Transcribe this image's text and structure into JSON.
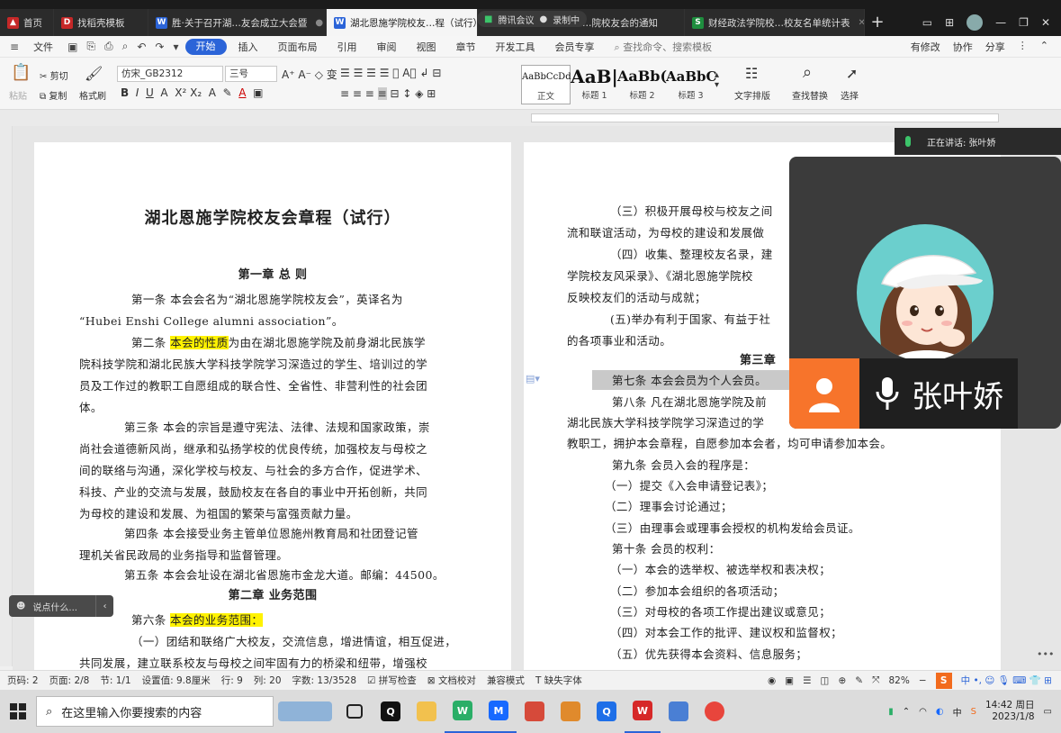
{
  "tabs": [
    {
      "label": "首页",
      "icon": "home-icon",
      "color": "#c62828"
    },
    {
      "label": "找稻壳模板",
      "icon": "docer-icon",
      "color": "#c62828"
    },
    {
      "label": "胜·关于召开湖…友会成立大会暨",
      "icon": "word-doc-icon",
      "color": "#2b64d8"
    },
    {
      "label": "湖北恩施学院校友…程（试行）(",
      "icon": "word-doc-icon",
      "color": "#2b64d8",
      "active": true
    },
    {
      "label": "…院校友会的通知",
      "icon": "word-doc-icon",
      "color": "#2b64d8"
    },
    {
      "label": "财经政法学院校…校友名单统计表",
      "icon": "sheet-icon",
      "color": "#1e8e3e"
    }
  ],
  "meeting_pill": {
    "app": "腾讯会议",
    "recording": "录制中"
  },
  "menubar": {
    "file": "文件",
    "items": [
      "开始",
      "插入",
      "页面布局",
      "引用",
      "审阅",
      "视图",
      "章节",
      "开发工具",
      "会员专享"
    ],
    "search_placeholder": "查找命令、搜索模板",
    "right": [
      "有修改",
      "协作",
      "分享"
    ]
  },
  "ribbon": {
    "paste": "粘贴",
    "cut": "剪切",
    "copy": "复制",
    "format_painter": "格式刷",
    "font_name": "仿宋_GB2312",
    "font_size": "三号",
    "styles": [
      {
        "preview": "AaBbCcDd",
        "label": "正文"
      },
      {
        "preview": "AaB|",
        "label": "标题 1"
      },
      {
        "preview": "AaBb(",
        "label": "标题 2"
      },
      {
        "preview": "AaBbC",
        "label": "标题 3"
      }
    ],
    "text_layout": "文字排版",
    "find_replace": "查找替换",
    "select": "选择"
  },
  "speaking": {
    "text": "正在讲话: 张叶娇"
  },
  "participant": {
    "name": "张叶娇"
  },
  "float_tool": {
    "placeholder": "说点什么..."
  },
  "page1": {
    "title": "湖北恩施学院校友会章程（试行）",
    "chapter1": "第一章  总    则",
    "lines": [
      "第一条   本会会名为“湖北恩施学院校友会”，英译名为",
      "“Hubei Enshi College alumni association”。",
      "第二条  ",
      "为由在湖北恩施学院及前身湖北民族学",
      "院科技学院和湖北民族大学科技学院学习深造过的学生、培训过的学",
      "员及工作过的教职工自愿组成的联合性、全省性、非营利性的社会团",
      "体。",
      "第三条   本会的宗旨是遵守宪法、法律、法规和国家政策，崇",
      "尚社会道德新风尚，继承和弘扬学校的优良传统，加强校友与母校之",
      "间的联络与沟通，深化学校与校友、与社会的多方合作，促进学术、",
      "科技、产业的交流与发展，鼓励校友在各自的事业中开拓创新，共同",
      "为母校的建设和发展、为祖国的繁荣与富强贡献力量。",
      "第四条   本会接受业务主管单位恩施州教育局和社团登记管",
      "理机关省民政局的业务指导和监督管理。",
      "第五条   本会会址设在湖北省恩施市金龙大道。邮编：44500。",
      "第六条  ",
      "（一）团结和联络广大校友，交流信息，增进情谊，相互促进，",
      "共同发展，建立联系校友与母校之间牢固有力的桥梁和纽带，增强校"
    ],
    "highlight1": "本会的性质",
    "chapter2": "第二章   业务范围",
    "highlight2": "本会的业务范围："
  },
  "page2": {
    "lines": [
      "（三）积极开展母校与校友之间",
      "流和联谊活动，为母校的建设和发展做",
      "（四）收集、整理校友名录，建",
      "学院校友风采录》、《湖北恩施学院校",
      "反映校友们的活动与成就；",
      "(五)举办有利于国家、有益于社",
      "的各项事业和活动。",
      "第三章",
      "第七条   本会会员为个人会员。",
      "第八条   凡在湖北恩施学院及前",
      "湖北民族大学科技学院学习深造过的学",
      "教职工，拥护本会章程，自愿参加本会者，均可申请参加本会。",
      "第九条   会员入会的程序是：",
      "（一）提交《入会申请登记表》；",
      "（二）理事会讨论通过；",
      "（三）由理事会或理事会授权的机构发给会员证。",
      "第十条   会员的权利：",
      "（一）本会的选举权、被选举权和表决权；",
      "（二）参加本会组织的各项活动；",
      "（三）对母校的各项工作提出建议或意见；",
      "（四）对本会工作的批评、建议权和监督权；",
      "（五）优先获得本会资料、信息服务；"
    ]
  },
  "statusbar": {
    "page_num": "页码: 2",
    "page": "页面: 2/8",
    "section": "节: 1/1",
    "setting": "设置值: 9.8厘米",
    "row": "行: 9",
    "col": "列: 20",
    "words": "字数: 13/3528",
    "spell": "拼写检查",
    "proof": "文档校对",
    "compat": "兼容模式",
    "missing_font": "缺失字体",
    "zoom": "82%"
  },
  "taskbar": {
    "search_placeholder": "在这里输入你要搜索的内容",
    "time": "14:42 周日",
    "date": "2023/1/8",
    "ime": "中"
  }
}
